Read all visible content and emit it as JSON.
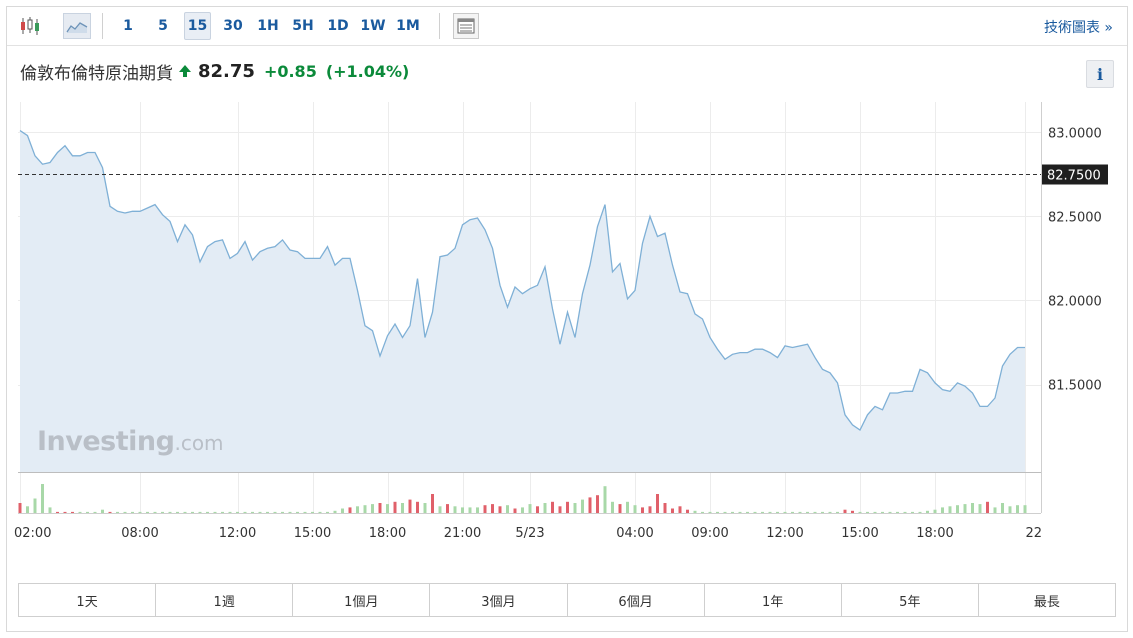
{
  "toolbar": {
    "chart_type_icons": [
      "candlestick-icon",
      "area-chart-icon"
    ],
    "intervals": [
      "1",
      "5",
      "15",
      "30",
      "1H",
      "5H",
      "1D",
      "1W",
      "1M"
    ],
    "active_interval": "15",
    "table_icon": "table-icon",
    "tech_label": "技術圖表 »"
  },
  "header": {
    "name": "倫敦布倫特原油期貨",
    "price": "82.75",
    "change": "+0.85",
    "change_pct": "(+1.04%)",
    "direction_icon": "up-arrow-icon",
    "info_label": "i"
  },
  "watermark": {
    "brand": "Investing",
    "suffix": ".com"
  },
  "ranges": [
    "1天",
    "1週",
    "1個月",
    "3個月",
    "6個月",
    "1年",
    "5年",
    "最長"
  ],
  "colors": {
    "line": "#7fb0d6",
    "area": "#e3ecf5",
    "up": "#0b8a3a",
    "vol_up": "#a8d8a8",
    "vol_down": "#e0606a"
  },
  "chart_data": {
    "type": "area",
    "current_value_label": "82.7500",
    "current_value": 82.75,
    "y_ticks": [
      "83.0000",
      "82.5000",
      "82.0000",
      "81.5000"
    ],
    "y_tick_values": [
      83.0,
      82.5,
      82.0,
      81.5
    ],
    "ylim": [
      80.98,
      83.18
    ],
    "x_tick_labels": [
      "02:00",
      "08:00",
      "12:00",
      "15:00",
      "18:00",
      "21:00",
      "5/23",
      "04:00",
      "09:00",
      "12:00",
      "15:00",
      "18:00",
      "22"
    ],
    "x_tick_index": [
      0,
      16,
      29,
      39,
      49,
      59,
      68,
      82,
      92,
      102,
      112,
      122,
      134
    ],
    "values": [
      83.01,
      82.98,
      82.86,
      82.81,
      82.82,
      82.88,
      82.92,
      82.86,
      82.86,
      82.88,
      82.88,
      82.79,
      82.56,
      82.53,
      82.52,
      82.53,
      82.53,
      82.55,
      82.57,
      82.51,
      82.47,
      82.35,
      82.45,
      82.39,
      82.23,
      82.32,
      82.35,
      82.36,
      82.25,
      82.28,
      82.35,
      82.24,
      82.29,
      82.31,
      82.32,
      82.36,
      82.3,
      82.29,
      82.25,
      82.25,
      82.25,
      82.32,
      82.21,
      82.25,
      82.25,
      82.06,
      81.85,
      81.82,
      81.67,
      81.79,
      81.86,
      81.78,
      81.85,
      82.13,
      81.78,
      81.93,
      82.26,
      82.27,
      82.31,
      82.45,
      82.48,
      82.49,
      82.42,
      82.31,
      82.09,
      81.96,
      82.08,
      82.04,
      82.07,
      82.09,
      82.2,
      81.95,
      81.74,
      81.93,
      81.78,
      82.04,
      82.21,
      82.44,
      82.57,
      82.17,
      82.22,
      82.01,
      82.06,
      82.34,
      82.5,
      82.38,
      82.4,
      82.21,
      82.05,
      82.04,
      81.92,
      81.89,
      81.78,
      81.71,
      81.65,
      81.68,
      81.69,
      81.69,
      81.71,
      81.71,
      81.69,
      81.66,
      81.73,
      81.72,
      81.73,
      81.74,
      81.66,
      81.59,
      81.57,
      81.51,
      81.32,
      81.26,
      81.23,
      81.32,
      81.37,
      81.35,
      81.45,
      81.45,
      81.46,
      81.46,
      81.59,
      81.57,
      81.51,
      81.47,
      81.46,
      81.51,
      81.49,
      81.45,
      81.37,
      81.37,
      81.42,
      81.61,
      81.68,
      81.72,
      81.72
    ],
    "volume_dir": [
      "d",
      "u",
      "u",
      "u",
      "u",
      "d",
      "d",
      "d",
      "u",
      "u",
      "u",
      "u",
      "d",
      "u",
      "u",
      "u",
      "u",
      "u",
      "u",
      "u",
      "u",
      "u",
      "u",
      "u",
      "u",
      "u",
      "u",
      "u",
      "u",
      "u",
      "u",
      "u",
      "u",
      "u",
      "u",
      "u",
      "u",
      "u",
      "u",
      "u",
      "u",
      "u",
      "u",
      "u",
      "d",
      "u",
      "u",
      "u",
      "d",
      "u",
      "d",
      "u",
      "d",
      "d",
      "u",
      "d",
      "u",
      "d",
      "u",
      "u",
      "u",
      "u",
      "d",
      "d",
      "d",
      "u",
      "d",
      "u",
      "u",
      "d",
      "u",
      "d",
      "d",
      "d",
      "u",
      "u",
      "d",
      "d",
      "u",
      "u",
      "d",
      "u",
      "u",
      "d",
      "d",
      "d",
      "d",
      "d",
      "d",
      "d",
      "u",
      "u",
      "u",
      "u",
      "u",
      "u",
      "u",
      "u",
      "u",
      "u",
      "u",
      "u",
      "u",
      "u",
      "u",
      "u",
      "u",
      "u",
      "u",
      "u",
      "d",
      "d",
      "u",
      "u",
      "u",
      "u",
      "u",
      "u",
      "u",
      "u",
      "u",
      "u",
      "u",
      "u",
      "u",
      "u",
      "u",
      "u",
      "u",
      "d",
      "u",
      "u",
      "u",
      "u",
      "u"
    ],
    "volume": [
      9,
      6,
      13,
      26,
      5,
      1,
      1,
      1,
      1,
      1,
      1,
      3,
      1,
      1,
      1,
      1,
      1,
      1,
      1,
      1,
      1,
      1,
      1,
      1,
      1,
      1,
      1,
      1,
      1,
      1,
      1,
      1,
      1,
      1,
      1,
      1,
      1,
      1,
      1,
      1,
      1,
      1,
      2,
      4,
      5,
      6,
      7,
      8,
      9,
      8,
      10,
      9,
      12,
      10,
      9,
      17,
      6,
      8,
      6,
      5,
      5,
      5,
      7,
      8,
      6,
      7,
      4,
      5,
      8,
      6,
      9,
      10,
      6,
      10,
      9,
      12,
      14,
      16,
      24,
      10,
      8,
      10,
      7,
      5,
      6,
      17,
      9,
      4,
      6,
      3,
      2,
      1,
      1,
      1,
      1,
      1,
      1,
      1,
      1,
      1,
      1,
      1,
      1,
      1,
      1,
      1,
      1,
      1,
      1,
      1,
      3,
      2,
      1,
      1,
      1,
      1,
      1,
      1,
      1,
      1,
      1,
      2,
      3,
      5,
      6,
      7,
      8,
      9,
      8,
      10,
      5,
      9,
      6,
      7,
      7
    ]
  }
}
